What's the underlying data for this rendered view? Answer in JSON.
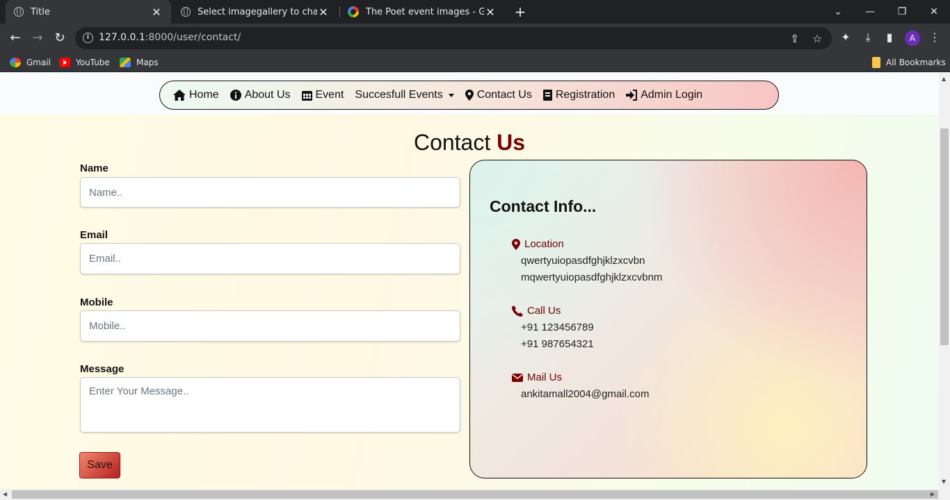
{
  "browser": {
    "tabs": [
      {
        "title": "Title",
        "active": true
      },
      {
        "title": "Select imagegallery to change | D",
        "active": false
      },
      {
        "title": "The Poet event images - Google",
        "active": false
      }
    ],
    "url_host": "127.0.0.1",
    "url_rest": ":8000/user/contact/",
    "profile_initial": "A",
    "bookmarks": [
      "Gmail",
      "YouTube",
      "Maps"
    ],
    "all_bookmarks": "All Bookmarks"
  },
  "nav": {
    "items": [
      {
        "label": "Home",
        "icon": "home-icon"
      },
      {
        "label": "About Us",
        "icon": "info-circle-icon"
      },
      {
        "label": "Event",
        "icon": "calendar-icon"
      },
      {
        "label": "Succesfull Events",
        "icon": "dropdown-caret-icon"
      },
      {
        "label": "Contact Us",
        "icon": "map-marker-icon"
      },
      {
        "label": "Registration",
        "icon": "address-book-icon"
      },
      {
        "label": "Admin Login",
        "icon": "sign-in-icon"
      }
    ]
  },
  "page": {
    "title_plain": "Contact",
    "title_accent": "Us"
  },
  "form": {
    "name_label": "Name",
    "name_placeholder": "Name..",
    "email_label": "Email",
    "email_placeholder": "Email..",
    "mobile_label": "Mobile",
    "mobile_placeholder": "Mobile..",
    "message_label": "Message",
    "message_placeholder": "Enter Your Message..",
    "save_label": "Save"
  },
  "contact_info": {
    "title": "Contact Info...",
    "location_label": "Location",
    "location_lines": [
      "qwertyuiopasdfghjklzxcvbn",
      "mqwertyuiopasdfghjklzxcvbnm"
    ],
    "call_label": "Call Us",
    "phones": [
      "+91 123456789",
      "+91 987654321"
    ],
    "mail_label": "Mail Us",
    "email": "ankitamall2004@gmail.com"
  },
  "colors": {
    "accent": "#7a0000",
    "save_button": "#c0392b"
  }
}
